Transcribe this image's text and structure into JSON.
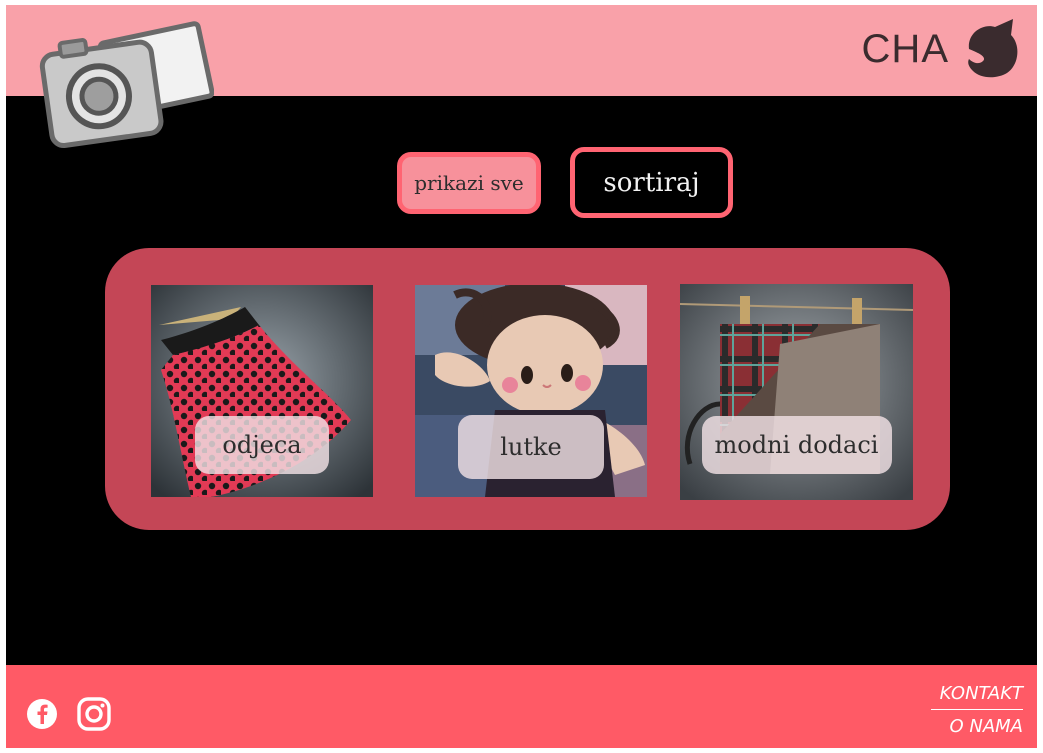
{
  "header": {
    "logo_icon": "camera-photos-icon",
    "brand_text": "CHA",
    "brand_icon": "cat-head-icon"
  },
  "filters": {
    "show_all_label": "prikazi sve",
    "sort_label": "sortiraj"
  },
  "categories": [
    {
      "label": "odjeca",
      "image": "red-polka-dot-skirt"
    },
    {
      "label": "lutke",
      "image": "rag-doll"
    },
    {
      "label": "modni dodaci",
      "image": "plaid-backpack"
    }
  ],
  "footer": {
    "social_icons": [
      "facebook-icon",
      "instagram-icon"
    ],
    "links": [
      "KONTAKT",
      "O NAMA"
    ]
  },
  "colors": {
    "header_bg": "#f9a1a9",
    "body_bg": "#000000",
    "panel_bg": "#c44656",
    "accent": "#ff6472",
    "footer_bg": "#ff5a66"
  }
}
